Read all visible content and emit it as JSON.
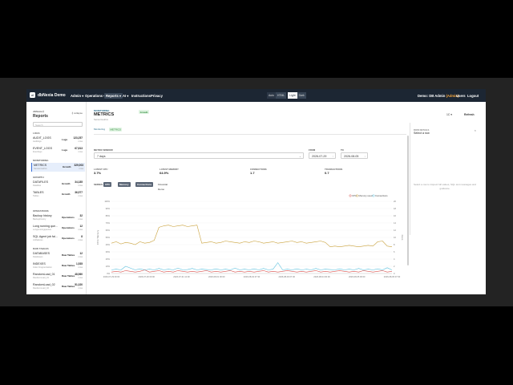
{
  "header": {
    "logo_letter": "d",
    "brand": "dbNexia Demo",
    "nav": [
      "Admin ▾",
      "Operations ▾",
      "Reports ▾",
      "AI ▾",
      "Instructions",
      "Privacy"
    ],
    "nav_active_index": 2,
    "view_toggle": {
      "label": "Auto",
      "badge": "HTML",
      "options": [
        "Light",
        "Dark"
      ],
      "selected": "Light"
    },
    "user_label": "Demo: DB Admin",
    "user_badge": "(Admin)",
    "users_link": "Users",
    "logout_link": "Logout"
  },
  "sidebar": {
    "kicker": "dbNexia ℹ",
    "title": "Reports",
    "collapse_label": "⟪ collapse",
    "search_placeholder": "Search",
    "sections": [
      {
        "label": "LOGS"
      },
      {
        "label": "MONITORING"
      },
      {
        "label": "GROWTH"
      },
      {
        "label": "OPERATIONS"
      },
      {
        "label": "RAW TABLES"
      }
    ],
    "items": [
      {
        "name": "AUDIT_LOGS",
        "sub": "Auditlogs",
        "tag": "Logs",
        "count": "123,257",
        "count_sub": "rows"
      },
      {
        "name": "EVENT_LOGS",
        "sub": "Eventlogs",
        "tag": "Logs",
        "count": "67,813",
        "count_sub": "rows"
      },
      {
        "name": "METRICS",
        "sub": "Sensormetrics",
        "tag": "Growth",
        "count": "329,003",
        "count_sub": "rows"
      },
      {
        "name": "DATAFILES",
        "sub": "Datafiles",
        "tag": "Growth",
        "count": "34,185",
        "count_sub": "rows"
      },
      {
        "name": "TABLES",
        "sub": "Tables",
        "tag": "Growth",
        "count": "36,577",
        "count_sub": "rows"
      },
      {
        "name": "Backup history",
        "sub": "Backuphistory",
        "tag": "Operations",
        "count": "32",
        "count_sub": "rows"
      },
      {
        "name": "Long running que...",
        "sub": "Longrunningqueries",
        "tag": "Operations",
        "count": "12",
        "count_sub": "rows"
      },
      {
        "name": "SQL Agent job fai...",
        "sub": "Jobfailures",
        "tag": "Operations",
        "count": "8",
        "count_sub": "rows"
      },
      {
        "name": "DATABASES",
        "sub": "Databases",
        "tag": "Raw Tables",
        "count": "12",
        "count_sub": "rows"
      },
      {
        "name": "INDEXES",
        "sub": "Index Fragmentation",
        "tag": "Raw Tables",
        "count": "1,535",
        "count_sub": "rows"
      },
      {
        "name": "RandomLoad_01",
        "sub": "RandomLoad_01",
        "tag": "Raw Tables",
        "count": "48,560",
        "count_sub": "rows"
      },
      {
        "name": "RandomLoad_02",
        "sub": "RandomLoad_02",
        "tag": "Raw Tables",
        "count": "51,320",
        "count_sub": "rows"
      }
    ]
  },
  "main": {
    "kicker": "MONITORING",
    "title": "METRICS",
    "badge": "Growth",
    "subtitle": "Sensormetrics",
    "crumb_a": "Monitoring",
    "crumb_b": "METRICS",
    "window_label": "METRIC WINDOW",
    "window_value": "7 days",
    "from_label": "FROM",
    "from_value": "2026-07-29",
    "to_label": "TO",
    "to_value": "2026-08-05",
    "stats": [
      {
        "label": "LATEST CPU",
        "value": "3.7%"
      },
      {
        "label": "LATEST MEMORY",
        "value": "64.9%"
      },
      {
        "label": "CONNECTIONS",
        "value": "1.7"
      },
      {
        "label": "TRANSACTIONS",
        "value": "0.7"
      }
    ],
    "series_label": "SERIES",
    "chips": [
      "CPU %",
      "Memory %",
      "Connections",
      "Financial Demo"
    ],
    "top_controls": {
      "zoom": "1C ▾",
      "refresh": "Refresh"
    }
  },
  "right_panel": {
    "kicker": "ROW DETAILS",
    "title": "Select a row",
    "close": "×",
    "message": "Select a row to inspect full values, SQL text messages and guidance."
  },
  "chart_data": {
    "type": "line",
    "x_ticks": [
      "2026-07-29 00:00",
      "2026-07-30 00:00",
      "2026-07-31 12:00",
      "2026-08-01 00:00",
      "2026-08-02 07:30",
      "2026-08-03 07:30",
      "2026-08-04 00:00",
      "2026-08-05 00:00",
      "2026-08-05 07:00"
    ],
    "y_left_label": "CPU / Memory",
    "y_left_ticks": [
      "0%",
      "10%",
      "20%",
      "30%",
      "40%",
      "50%",
      "60%",
      "70%",
      "80%",
      "90%",
      "100%"
    ],
    "y_right_label": "Conn",
    "y_right_ticks": [
      "0",
      "2",
      "4",
      "6",
      "8",
      "10",
      "12",
      "14",
      "16",
      "18",
      "20"
    ],
    "ylim_left": [
      0,
      100
    ],
    "ylim_right": [
      0,
      20
    ],
    "legend_position": "top-right",
    "series": [
      {
        "name": "CPU",
        "color": "#d9534f",
        "axis": "left",
        "values": [
          2,
          3,
          2,
          4,
          3,
          2,
          3,
          5,
          2,
          3,
          4,
          2,
          3,
          2,
          4,
          3,
          2,
          3,
          2,
          3,
          4,
          2,
          3,
          2,
          3,
          4,
          2,
          3,
          2,
          3,
          2,
          3,
          4,
          2,
          3,
          2,
          3,
          4,
          3,
          2,
          3,
          2,
          3,
          4,
          2,
          3,
          2,
          3,
          4,
          3,
          2,
          3,
          2,
          4,
          3,
          2,
          3,
          4,
          2,
          3
        ]
      },
      {
        "name": "Memory used",
        "color": "#c9a13b",
        "axis": "left",
        "values": [
          42,
          44,
          41,
          43,
          42,
          40,
          44,
          42,
          43,
          46,
          64,
          66,
          67,
          65,
          66,
          67,
          65,
          66,
          67,
          42,
          43,
          44,
          42,
          43,
          45,
          44,
          43,
          42,
          44,
          43,
          45,
          44,
          42,
          43,
          44,
          42,
          43,
          44,
          45,
          43,
          44,
          42,
          43,
          44,
          45,
          43,
          37,
          38,
          37,
          38,
          39,
          38,
          37,
          38,
          39,
          38,
          44,
          45,
          38,
          37
        ]
      },
      {
        "name": "Connections",
        "color": "#5bc0de",
        "axis": "right",
        "values": [
          1,
          1.2,
          1,
          2,
          1.5,
          1,
          1.3,
          1,
          1.2,
          1,
          1.4,
          1,
          1.2,
          1,
          1.5,
          1,
          1.1,
          1.4,
          1,
          1.2,
          1.1,
          1,
          1.3,
          1,
          1.2,
          1,
          1.5,
          1,
          1.2,
          1,
          1.3,
          1,
          1.4,
          1,
          1.2,
          3,
          1,
          1.2,
          1,
          1.3,
          1,
          1.2,
          1,
          1.4,
          1,
          1.2,
          1.1,
          1,
          1.3,
          1,
          1.2,
          1,
          1.4,
          1,
          1.2,
          1,
          1.3,
          1,
          1.6,
          1
        ]
      }
    ]
  }
}
